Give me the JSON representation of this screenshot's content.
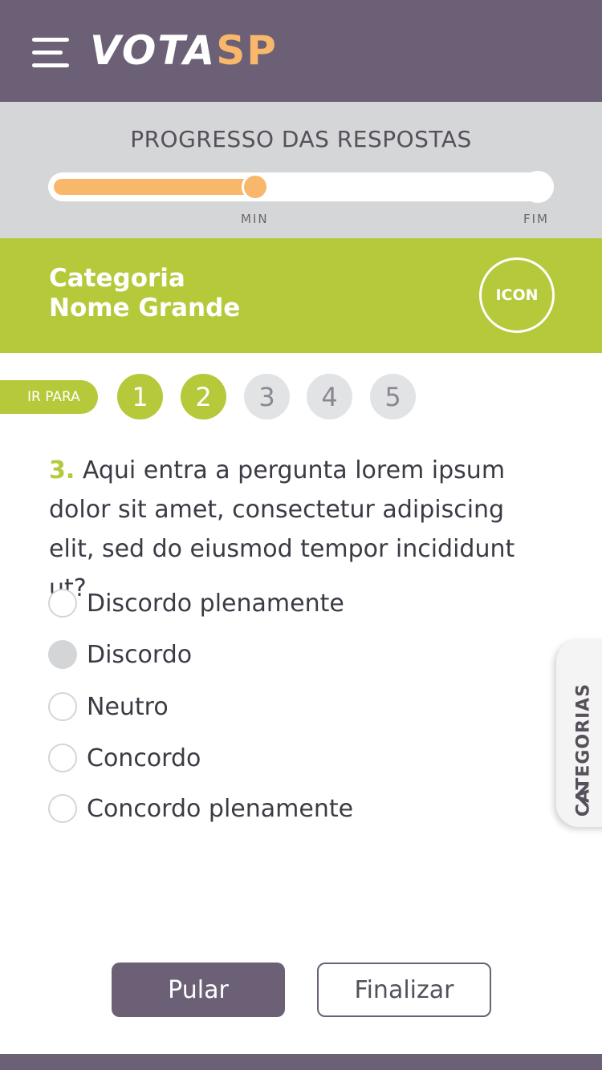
{
  "app": {
    "logo_part1": "VOTA",
    "logo_part2": "SP",
    "colors": {
      "primary": "#6b6075",
      "accent_green": "#b6c93b",
      "accent_orange": "#f8b76a"
    }
  },
  "progress": {
    "title": "PROGRESSO DAS RESPOSTAS",
    "value_percent": 41,
    "min_label": "MIN",
    "end_label": "FIM"
  },
  "category": {
    "line1": "Categoria",
    "line2": "Nome Grande",
    "icon_label": "ICON"
  },
  "navigation": {
    "goto_label": "IR PARA",
    "questions": [
      {
        "label": "1",
        "state": "answered"
      },
      {
        "label": "2",
        "state": "answered"
      },
      {
        "label": "3",
        "state": "pending"
      },
      {
        "label": "4",
        "state": "pending"
      },
      {
        "label": "5",
        "state": "pending"
      }
    ]
  },
  "question": {
    "number": "3.",
    "text": "Aqui entra a pergunta lorem ipsum dolor sit amet, consectetur adipiscing elit, sed do eiusmod tempor incididunt ut?"
  },
  "options": [
    {
      "label": "Discordo plenamente",
      "selected": false
    },
    {
      "label": "Discordo",
      "selected": true
    },
    {
      "label": "Neutro",
      "selected": false
    },
    {
      "label": "Concordo",
      "selected": false
    },
    {
      "label": "Concordo plenamente",
      "selected": false
    }
  ],
  "side_tab": {
    "label": "CATEGORIAS",
    "icon": "chevron-left-icon"
  },
  "actions": {
    "skip_label": "Pular",
    "finish_label": "Finalizar"
  }
}
